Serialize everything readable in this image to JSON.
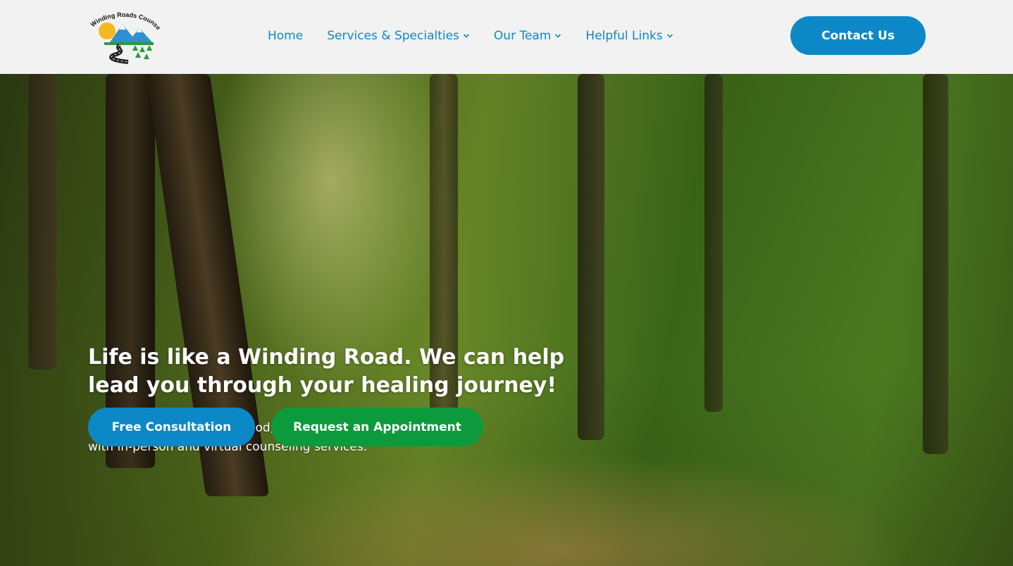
{
  "brand": {
    "logo_text": "Winding Roads Counseling"
  },
  "nav": {
    "items": [
      {
        "label": "Home",
        "has_dropdown": false
      },
      {
        "label": "Services & Specialties",
        "has_dropdown": true
      },
      {
        "label": "Our Team",
        "has_dropdown": true
      },
      {
        "label": "Helpful Links",
        "has_dropdown": true
      }
    ],
    "contact_label": "Contact Us"
  },
  "hero": {
    "title": "Life is like a Winding Road. We can help lead you through your healing journey!",
    "subtitle_line1": "Servicing Franklin, Greenwood, and Lafayette, Indiana",
    "subtitle_line2": "with in-person and virtual counseling services.",
    "primary_button": "Free Consultation",
    "secondary_button": "Request an Appointment"
  },
  "colors": {
    "accent_blue": "#0c88c7",
    "accent_green": "#0d9a3c",
    "header_bg": "#f2f2f2"
  }
}
